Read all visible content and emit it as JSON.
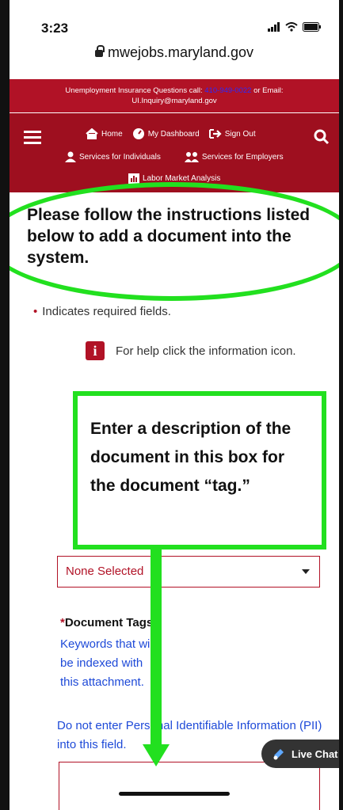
{
  "status": {
    "time": "3:23"
  },
  "browser": {
    "url": "mwejobs.maryland.gov"
  },
  "banner": {
    "prefix": "Unemployment Insurance Questions call:",
    "phone": "410-949-0022",
    "suffix": "or Email:",
    "email": "UI.Inquiry@maryland.gov"
  },
  "nav": {
    "home": "Home",
    "dashboard": "My Dashboard",
    "signout": "Sign Out",
    "individuals": "Services for Individuals",
    "employers": "Services for Employers",
    "lma": "Labor Market Analysis"
  },
  "page": {
    "heading": "Please follow the instructions listed below to add a document into the system.",
    "required_note": "Indicates required fields.",
    "help_text": "For help click the information icon.",
    "callout_text": "Enter a description of the document in this box for the document “tag.”",
    "select_value": "None Selected",
    "doc_tags_label": "Document Tags:",
    "doc_tags_help_lines": [
      "Keywords that will",
      "be indexed with",
      "this attachment."
    ],
    "pii_note": "Do not enter Personal Identifiable Information (PII) into this field."
  },
  "chat": {
    "label": "Live Chat"
  },
  "colors": {
    "annotation": "#22e01f",
    "brand_red": "#b11226",
    "link_blue": "#1e4ad8"
  }
}
